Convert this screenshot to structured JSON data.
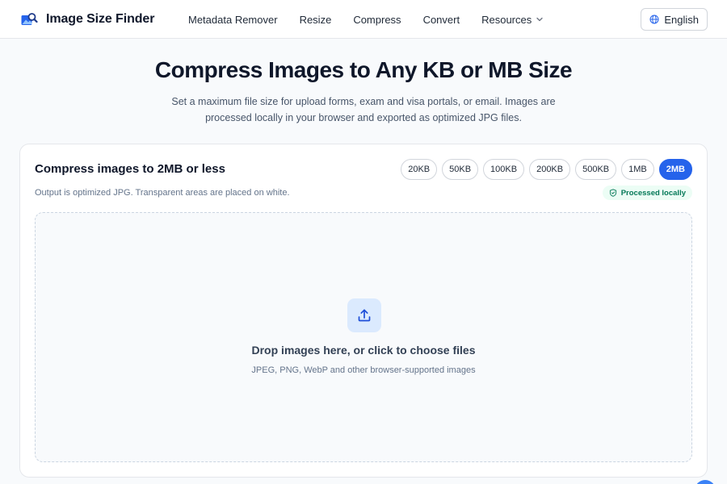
{
  "header": {
    "brand": "Image Size Finder",
    "nav": [
      "Metadata Remover",
      "Resize",
      "Compress",
      "Convert"
    ],
    "resources_label": "Resources",
    "language": "English"
  },
  "hero": {
    "title": "Compress Images to Any KB or MB Size",
    "subtitle": "Set a maximum file size for upload forms, exam and visa portals, or email. Images are processed locally in your browser and exported as optimized JPG files."
  },
  "card": {
    "title": "Compress images to 2MB or less",
    "subtitle": "Output is optimized JPG. Transparent areas are placed on white.",
    "sizes": [
      "20KB",
      "50KB",
      "100KB",
      "200KB",
      "500KB",
      "1MB",
      "2MB"
    ],
    "selected_size": "2MB",
    "badge": "Processed locally",
    "dropzone": {
      "title": "Drop images here, or click to choose files",
      "subtitle": "JPEG, PNG, WebP and other browser-supported images"
    }
  },
  "icons": {
    "logo": "image-search-logo-icon",
    "language": "globe-icon",
    "resources": "chevron-down-icon",
    "badge": "shield-check-icon",
    "dropzone": "upload-icon"
  },
  "colors": {
    "accent": "#2563eb",
    "badge_text": "#047857",
    "badge_bg": "#ecfdf5",
    "upload_bg": "#dbeafe"
  }
}
